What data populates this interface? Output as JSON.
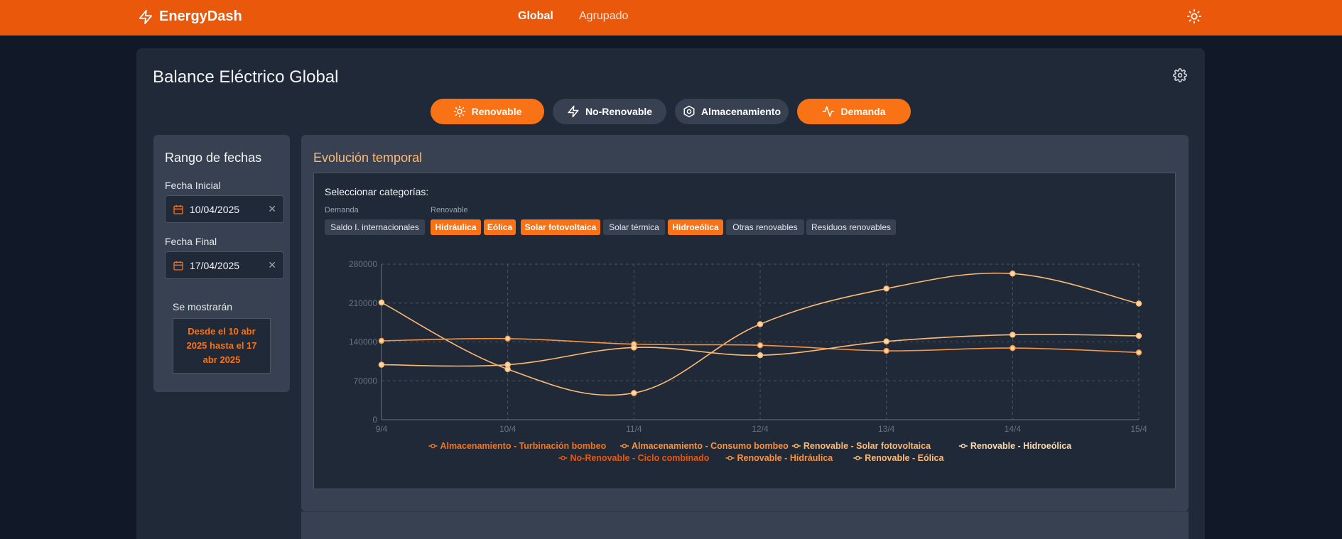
{
  "header": {
    "brand": "EnergyDash",
    "nav": [
      {
        "label": "Global",
        "active": true
      },
      {
        "label": "Agrupado",
        "active": false
      }
    ]
  },
  "page": {
    "title": "Balance Eléctrico Global"
  },
  "categories": [
    {
      "label": "Renovable",
      "icon": "sun-icon",
      "active": true
    },
    {
      "label": "No-Renovable",
      "icon": "bolt-icon",
      "active": false
    },
    {
      "label": "Almacenamiento",
      "icon": "hexagon-icon",
      "active": false
    },
    {
      "label": "Demanda",
      "icon": "activity-icon",
      "active": true
    }
  ],
  "date_range": {
    "title": "Rango de fechas",
    "start_label": "Fecha Inicial",
    "start_value": "10/04/2025",
    "end_label": "Fecha Final",
    "end_value": "17/04/2025",
    "clear_symbol": "✕",
    "show_label": "Se mostrarán",
    "summary": "Desde el 10 abr 2025 hasta el 17 abr 2025"
  },
  "panel": {
    "title": "Evolución temporal",
    "select_title": "Seleccionar categorías:",
    "groups": [
      {
        "label": "Demanda",
        "chips": [
          {
            "label": "Saldo I. internacionales",
            "active": false
          }
        ]
      },
      {
        "label": "Renovable",
        "chips": [
          {
            "label": "Hidráulica",
            "active": true
          },
          {
            "label": "Eólica",
            "active": true
          },
          {
            "label": "Solar fotovoltaica",
            "active": true
          },
          {
            "label": "Solar térmica",
            "active": false
          },
          {
            "label": "Hidroeólica",
            "active": true
          },
          {
            "label": "Otras renovables",
            "active": false
          },
          {
            "label": "Residuos renovables",
            "active": false
          }
        ]
      }
    ]
  },
  "colors": {
    "accent": "#f97316",
    "header": "#ea580c",
    "series_palette": [
      "#f97316",
      "#fb923c",
      "#fdba74",
      "#fed7aa",
      "#ea580c",
      "#fb923c",
      "#fdba74"
    ]
  },
  "chart_data": {
    "type": "line",
    "x": [
      "9/4",
      "10/4",
      "11/4",
      "12/4",
      "13/4",
      "14/4",
      "15/4"
    ],
    "ylim": [
      0,
      280000
    ],
    "yticks": [
      0,
      70000,
      140000,
      210000,
      280000
    ],
    "grid": true,
    "legend_position": "bottom",
    "series": [
      {
        "name": "Almacenamiento - Turbinación bombeo",
        "color": "#f97316",
        "values": [
          null,
          null,
          null,
          null,
          null,
          null,
          null
        ]
      },
      {
        "name": "Almacenamiento - Consumo bombeo",
        "color": "#fb923c",
        "values": [
          null,
          null,
          null,
          null,
          null,
          null,
          null
        ]
      },
      {
        "name": "Renovable - Solar fotovoltaica",
        "color": "#fdba74",
        "values": [
          211000,
          91000,
          48000,
          172000,
          236000,
          263000,
          209000
        ]
      },
      {
        "name": "Renovable - Hidroeólica",
        "color": "#fed7aa",
        "values": [
          null,
          null,
          null,
          null,
          null,
          null,
          null
        ]
      },
      {
        "name": "No-Renovable - Ciclo combinado",
        "color": "#ea580c",
        "values": [
          null,
          null,
          null,
          null,
          null,
          null,
          null
        ]
      },
      {
        "name": "Renovable - Hidráulica",
        "color": "#fb923c",
        "values": [
          142000,
          146000,
          136000,
          134000,
          124000,
          129000,
          121000
        ]
      },
      {
        "name": "Renovable - Eólica",
        "color": "#fdba74",
        "values": [
          99000,
          99000,
          130000,
          116000,
          141000,
          153000,
          151000
        ]
      }
    ]
  }
}
